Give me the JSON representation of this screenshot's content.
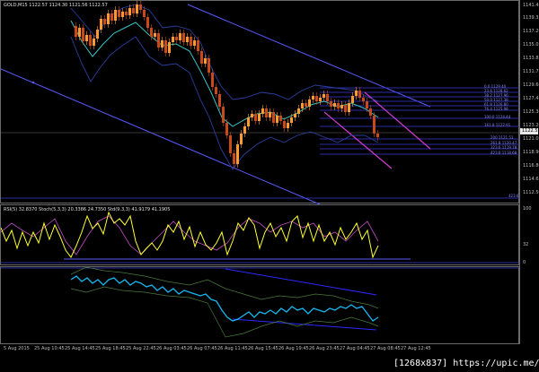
{
  "title": "GOLD,M15  1122.57 1124.30 1121.56 1122.57",
  "rsi_label": "RSI(5) 32.8370  Stoch(5,3,3) 20.3386 24.7350  Std(9,3,3) 41.9179 41.1905",
  "current_price": "1122.57",
  "price_scale": [
    "1141.45",
    "1139.35",
    "1137.20",
    "1135.05",
    "1133.85",
    "1131.75",
    "1129.60",
    "1127.45",
    "1125.30",
    "1123.20",
    "1121.05",
    "1118.90",
    "1116.80",
    "1114.65",
    "1112.50"
  ],
  "rsi_scale": [
    "100",
    "32",
    "0"
  ],
  "time_labels": [
    "5 Aug 2015",
    "25 Aug 10:45",
    "25 Aug 14:45",
    "25 Aug 18:45",
    "25 Aug 22:45",
    "26 Aug 03:45",
    "26 Aug 07:45",
    "26 Aug 11:45",
    "26 Aug 15:45",
    "26 Aug 19:45",
    "26 Aug 23:45",
    "27 Aug 04:45",
    "27 Aug 08:45",
    "27 Aug 12:45"
  ],
  "fib_levels": [
    "0.0  1129.40",
    "23.6  1128.62",
    "38.2  1127.96",
    "50.0  1127.38",
    "61.8  1126.80",
    "76.4  1125.98",
    "100.0  1124.44",
    "161.8  1122.91",
    "200  1121.51",
    "261.8  1120.47",
    "323.6  1119.78",
    "423.6  1118.68",
    "1001.0"
  ],
  "fib_right": "423.6",
  "watermark": "[1268x837] https://upic.me/",
  "colors": {
    "bull": "#ff9a2e",
    "bear": "#c84a1a",
    "band": "#2a3f9f",
    "ma": "#37c2c2",
    "rsi": "#ffff33",
    "stoch": "#c44ec4",
    "channel": "#5a5aff",
    "fib": "#3b3bd6",
    "fibpink": "#d33bd3",
    "osc": "#19b7f0",
    "osc2": "#4a7a3a"
  }
}
